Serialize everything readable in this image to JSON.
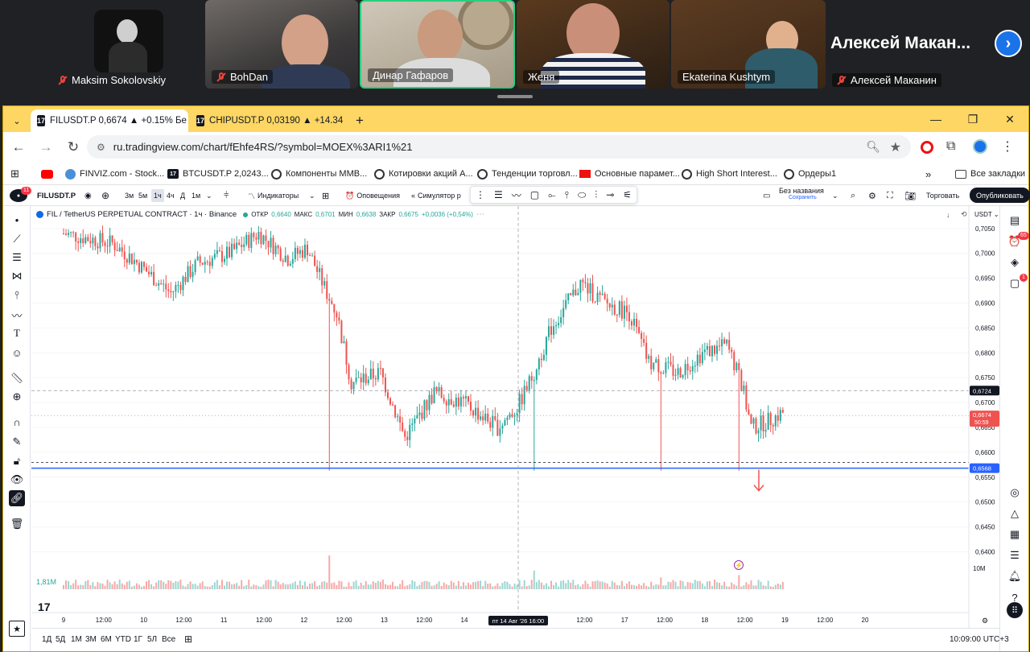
{
  "call": {
    "participants": [
      {
        "name": "Maksim Sokolovskiy"
      },
      {
        "name": "BohDan"
      },
      {
        "name": "Динар Гафаров"
      },
      {
        "name": "Женя"
      },
      {
        "name": "Ekaterina Kushtym"
      },
      {
        "name": "Алексей Маканин"
      }
    ],
    "speaker_big_name": "Алексей  Макан...",
    "next_icon": "chevron-right-icon"
  },
  "browser": {
    "tabs": [
      {
        "title": "FILUSDT.P 0,6674 ▲ +0.15% Бе"
      },
      {
        "title": "CHIPUSDT.P 0,03190 ▲ +14.34"
      }
    ],
    "url": "ru.tradingview.com/chart/fEhfe4RS/?symbol=MOEX%3ARI1%21",
    "bookmarks": [
      {
        "label": "FINVIZ.com - Stock..."
      },
      {
        "label": "BTCUSDT.P 2,0243..."
      },
      {
        "label": "Компоненты MMB..."
      },
      {
        "label": "Котировки акций А..."
      },
      {
        "label": "Тенденции торговл..."
      },
      {
        "label": "Основные парамет..."
      },
      {
        "label": "High Short Interest..."
      },
      {
        "label": "Ордеры1"
      }
    ],
    "all_bookmarks": "Все закладки",
    "accent": "#fdd663"
  },
  "tv": {
    "symbol": "FILUSDT.P",
    "notif_count": "11",
    "intervals": [
      "3м",
      "5м",
      "1ч",
      "4ч",
      "Д",
      "1м"
    ],
    "indicators": "Индикаторы",
    "alerts": "Оповещения",
    "replay": "Симулятор р",
    "layout_name": "Без названия",
    "layout_status": "Сохранить",
    "trade": "Торговать",
    "publish": "Опубликовать",
    "legend_title": "FIL / TetherUS PERPETUAL CONTRACT · 1ч · Binance",
    "ohlc_open_label": "ОТКР",
    "ohlc_open": "0,6640",
    "ohlc_high_label": "МАКС",
    "ohlc_high": "0,6701",
    "ohlc_low_label": "МИН",
    "ohlc_low": "0,6638",
    "ohlc_close_label": "ЗАКР",
    "ohlc_close": "0,6675",
    "ohlc_change": "+0,0036 (+0,54%)",
    "currency": "USDT",
    "volume_label": "1,81M",
    "volume_axis": "10M",
    "price_labels": {
      "crosshair": "0,6724",
      "last": "0,6674",
      "countdown": "50:59",
      "hline": "0,6568"
    },
    "ranges": [
      "1Д",
      "5Д",
      "1M",
      "3M",
      "6M",
      "YTD",
      "1Г",
      "5Л",
      "Все"
    ],
    "clock": "10:09:00 UTC+3",
    "right_badges": {
      "alerts": "65",
      "chat": "1"
    },
    "colors": {
      "up": "#26a69a",
      "down": "#ef5350",
      "hline": "#2962ff"
    }
  },
  "chart_data": {
    "type": "candlestick",
    "y_ticks": [
      "0,7050",
      "0,7000",
      "0,6950",
      "0,6900",
      "0,6850",
      "0,6800",
      "0,6750",
      "0,6700",
      "0,6650",
      "0,6600",
      "0,6550",
      "0,6500",
      "0,6450",
      "0,6400"
    ],
    "ylim": [
      0.637,
      0.7095
    ],
    "x_ticks": [
      "9",
      "12:00",
      "10",
      "12:00",
      "11",
      "12:00",
      "12",
      "12:00",
      "13",
      "12:00",
      "14",
      "12:00",
      "16",
      "12:00",
      "17",
      "12:00",
      "18",
      "12:00",
      "19",
      "12:00",
      "20"
    ],
    "crosshair_x_label": "пт 14 Авг '26   16:00",
    "horizontal_line": 0.6568,
    "waypoints": [
      [
        0,
        0.704
      ],
      [
        20,
        0.702
      ],
      [
        28,
        0.699
      ],
      [
        44,
        0.692
      ],
      [
        55,
        0.698
      ],
      [
        68,
        0.7
      ],
      [
        80,
        0.704
      ],
      [
        92,
        0.699
      ],
      [
        100,
        0.701
      ],
      [
        108,
        0.692
      ],
      [
        112,
        0.688
      ],
      [
        118,
        0.674
      ],
      [
        130,
        0.676
      ],
      [
        140,
        0.663
      ],
      [
        152,
        0.672
      ],
      [
        164,
        0.67
      ],
      [
        178,
        0.665
      ],
      [
        186,
        0.669
      ],
      [
        192,
        0.675
      ],
      [
        200,
        0.685
      ],
      [
        212,
        0.694
      ],
      [
        222,
        0.69
      ],
      [
        232,
        0.688
      ],
      [
        240,
        0.678
      ],
      [
        252,
        0.676
      ],
      [
        262,
        0.68
      ],
      [
        272,
        0.6815
      ],
      [
        278,
        0.674
      ],
      [
        282,
        0.665
      ],
      [
        288,
        0.666
      ],
      [
        295,
        0.668
      ]
    ],
    "volume_spikes": [
      [
        109,
        1.0
      ],
      [
        193,
        0.55
      ],
      [
        245,
        0.35
      ],
      [
        277,
        0.42
      ]
    ]
  }
}
